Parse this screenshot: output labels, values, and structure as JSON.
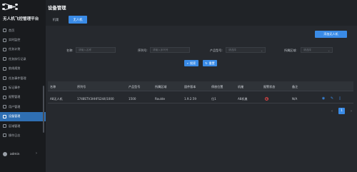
{
  "app": {
    "title": "无人机飞控管理平台"
  },
  "sidebar": {
    "items": [
      {
        "label": "首页",
        "icon": "home-icon"
      },
      {
        "label": "实时监控",
        "icon": "monitor-icon"
      },
      {
        "label": "任务计划",
        "icon": "calendar-icon"
      },
      {
        "label": "任务执行记录",
        "icon": "list-icon"
      },
      {
        "label": "航线规划",
        "icon": "route-icon"
      },
      {
        "label": "任务事件管理",
        "icon": "event-icon"
      },
      {
        "label": "标记事件",
        "icon": "flag-icon"
      },
      {
        "label": "报警管理",
        "icon": "alarm-icon"
      },
      {
        "label": "用户管理",
        "icon": "user-icon"
      },
      {
        "label": "设备管理",
        "icon": "device-icon",
        "active": true
      },
      {
        "label": "区域管理",
        "icon": "area-icon"
      },
      {
        "label": "操作日志",
        "icon": "log-icon"
      }
    ],
    "user": "admin",
    "active_color": "#2f6fb3"
  },
  "header": {
    "page_title": "设备管理",
    "tabs": [
      {
        "label": "机巢"
      },
      {
        "label": "无人机",
        "active": true
      }
    ]
  },
  "toolbar": {
    "add_label": "添加无人机"
  },
  "filters": {
    "name": {
      "label": "名称:",
      "placeholder": "请输入名称"
    },
    "serial": {
      "label": "序列号:",
      "placeholder": "请输入序列号"
    },
    "model": {
      "label": "产品型号:",
      "placeholder": "请选择"
    },
    "region": {
      "label": "所属区域:",
      "placeholder": "请选择"
    },
    "search_label": "搜索",
    "reset_label": "重置"
  },
  "table": {
    "columns": [
      "名称",
      "序列号",
      "产品型号",
      "所属区域",
      "固件版本",
      "停放位置",
      "机巢",
      "报警状态",
      "备注"
    ],
    "rows": [
      {
        "name": "A8无人机",
        "serial": "1748STV3HHFS244/1000",
        "model": "1500",
        "region": "Roulde",
        "firmware": "1.9.2.59",
        "position": "位1",
        "dock": "A8机巢",
        "alarm_color": "#e04545",
        "remark": "N/A"
      }
    ]
  },
  "pagination": {
    "current": "1"
  },
  "colors": {
    "accent": "#3a8be6",
    "alarm": "#e04545",
    "background": "#202327"
  }
}
